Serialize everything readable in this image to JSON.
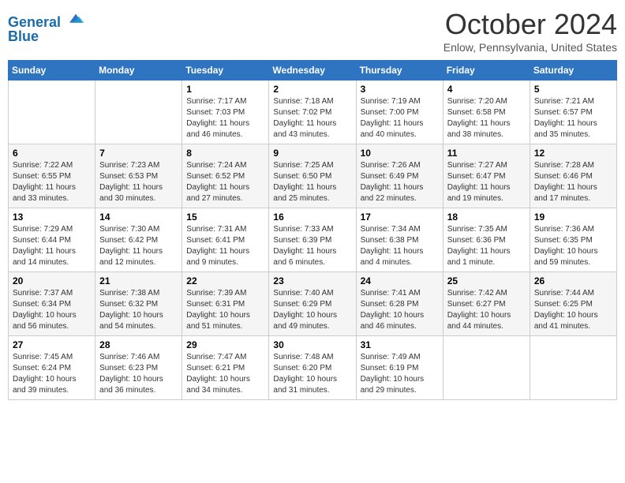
{
  "header": {
    "logo_line1": "General",
    "logo_line2": "Blue",
    "month_title": "October 2024",
    "location": "Enlow, Pennsylvania, United States"
  },
  "weekdays": [
    "Sunday",
    "Monday",
    "Tuesday",
    "Wednesday",
    "Thursday",
    "Friday",
    "Saturday"
  ],
  "weeks": [
    [
      {
        "day": "",
        "info": ""
      },
      {
        "day": "",
        "info": ""
      },
      {
        "day": "1",
        "info": "Sunrise: 7:17 AM\nSunset: 7:03 PM\nDaylight: 11 hours and 46 minutes."
      },
      {
        "day": "2",
        "info": "Sunrise: 7:18 AM\nSunset: 7:02 PM\nDaylight: 11 hours and 43 minutes."
      },
      {
        "day": "3",
        "info": "Sunrise: 7:19 AM\nSunset: 7:00 PM\nDaylight: 11 hours and 40 minutes."
      },
      {
        "day": "4",
        "info": "Sunrise: 7:20 AM\nSunset: 6:58 PM\nDaylight: 11 hours and 38 minutes."
      },
      {
        "day": "5",
        "info": "Sunrise: 7:21 AM\nSunset: 6:57 PM\nDaylight: 11 hours and 35 minutes."
      }
    ],
    [
      {
        "day": "6",
        "info": "Sunrise: 7:22 AM\nSunset: 6:55 PM\nDaylight: 11 hours and 33 minutes."
      },
      {
        "day": "7",
        "info": "Sunrise: 7:23 AM\nSunset: 6:53 PM\nDaylight: 11 hours and 30 minutes."
      },
      {
        "day": "8",
        "info": "Sunrise: 7:24 AM\nSunset: 6:52 PM\nDaylight: 11 hours and 27 minutes."
      },
      {
        "day": "9",
        "info": "Sunrise: 7:25 AM\nSunset: 6:50 PM\nDaylight: 11 hours and 25 minutes."
      },
      {
        "day": "10",
        "info": "Sunrise: 7:26 AM\nSunset: 6:49 PM\nDaylight: 11 hours and 22 minutes."
      },
      {
        "day": "11",
        "info": "Sunrise: 7:27 AM\nSunset: 6:47 PM\nDaylight: 11 hours and 19 minutes."
      },
      {
        "day": "12",
        "info": "Sunrise: 7:28 AM\nSunset: 6:46 PM\nDaylight: 11 hours and 17 minutes."
      }
    ],
    [
      {
        "day": "13",
        "info": "Sunrise: 7:29 AM\nSunset: 6:44 PM\nDaylight: 11 hours and 14 minutes."
      },
      {
        "day": "14",
        "info": "Sunrise: 7:30 AM\nSunset: 6:42 PM\nDaylight: 11 hours and 12 minutes."
      },
      {
        "day": "15",
        "info": "Sunrise: 7:31 AM\nSunset: 6:41 PM\nDaylight: 11 hours and 9 minutes."
      },
      {
        "day": "16",
        "info": "Sunrise: 7:33 AM\nSunset: 6:39 PM\nDaylight: 11 hours and 6 minutes."
      },
      {
        "day": "17",
        "info": "Sunrise: 7:34 AM\nSunset: 6:38 PM\nDaylight: 11 hours and 4 minutes."
      },
      {
        "day": "18",
        "info": "Sunrise: 7:35 AM\nSunset: 6:36 PM\nDaylight: 11 hours and 1 minute."
      },
      {
        "day": "19",
        "info": "Sunrise: 7:36 AM\nSunset: 6:35 PM\nDaylight: 10 hours and 59 minutes."
      }
    ],
    [
      {
        "day": "20",
        "info": "Sunrise: 7:37 AM\nSunset: 6:34 PM\nDaylight: 10 hours and 56 minutes."
      },
      {
        "day": "21",
        "info": "Sunrise: 7:38 AM\nSunset: 6:32 PM\nDaylight: 10 hours and 54 minutes."
      },
      {
        "day": "22",
        "info": "Sunrise: 7:39 AM\nSunset: 6:31 PM\nDaylight: 10 hours and 51 minutes."
      },
      {
        "day": "23",
        "info": "Sunrise: 7:40 AM\nSunset: 6:29 PM\nDaylight: 10 hours and 49 minutes."
      },
      {
        "day": "24",
        "info": "Sunrise: 7:41 AM\nSunset: 6:28 PM\nDaylight: 10 hours and 46 minutes."
      },
      {
        "day": "25",
        "info": "Sunrise: 7:42 AM\nSunset: 6:27 PM\nDaylight: 10 hours and 44 minutes."
      },
      {
        "day": "26",
        "info": "Sunrise: 7:44 AM\nSunset: 6:25 PM\nDaylight: 10 hours and 41 minutes."
      }
    ],
    [
      {
        "day": "27",
        "info": "Sunrise: 7:45 AM\nSunset: 6:24 PM\nDaylight: 10 hours and 39 minutes."
      },
      {
        "day": "28",
        "info": "Sunrise: 7:46 AM\nSunset: 6:23 PM\nDaylight: 10 hours and 36 minutes."
      },
      {
        "day": "29",
        "info": "Sunrise: 7:47 AM\nSunset: 6:21 PM\nDaylight: 10 hours and 34 minutes."
      },
      {
        "day": "30",
        "info": "Sunrise: 7:48 AM\nSunset: 6:20 PM\nDaylight: 10 hours and 31 minutes."
      },
      {
        "day": "31",
        "info": "Sunrise: 7:49 AM\nSunset: 6:19 PM\nDaylight: 10 hours and 29 minutes."
      },
      {
        "day": "",
        "info": ""
      },
      {
        "day": "",
        "info": ""
      }
    ]
  ]
}
